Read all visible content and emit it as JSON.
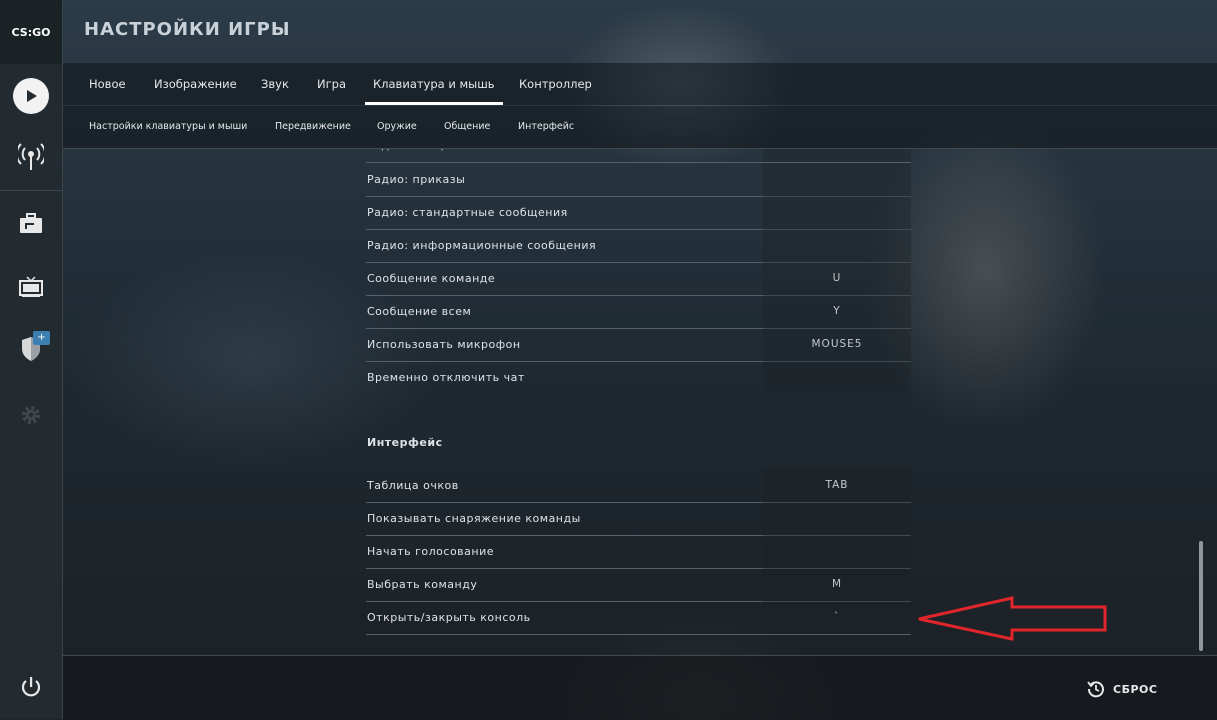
{
  "app": {
    "logo_text": "CS:GO",
    "page_title": "НАСТРОЙКИ ИГРЫ"
  },
  "sidebar": {
    "icons": [
      "play-icon",
      "broadcast-icon",
      "briefcase-icon",
      "tv-icon",
      "shield-icon",
      "gear-icon",
      "power-icon"
    ],
    "badge": "+"
  },
  "tabs": [
    {
      "label": "Новое"
    },
    {
      "label": "Изображение"
    },
    {
      "label": "Звук"
    },
    {
      "label": "Игра"
    },
    {
      "label": "Клавиатура и мышь",
      "active": true
    },
    {
      "label": "Контроллер"
    }
  ],
  "subtabs": [
    {
      "label": "Настройки клавиатуры и мыши"
    },
    {
      "label": "Передвижение"
    },
    {
      "label": "Оружие"
    },
    {
      "label": "Общение"
    },
    {
      "label": "Интерфейс"
    }
  ],
  "communication_rows": [
    {
      "label": "Радиосообщение",
      "key": ""
    },
    {
      "label": "Радио: приказы",
      "key": ""
    },
    {
      "label": "Радио: стандартные сообщения",
      "key": ""
    },
    {
      "label": "Радио: информационные сообщения",
      "key": ""
    },
    {
      "label": "Сообщение команде",
      "key": "U"
    },
    {
      "label": "Сообщение всем",
      "key": "Y"
    },
    {
      "label": "Использовать микрофон",
      "key": "MOUSE5"
    },
    {
      "label": "Временно отключить чат",
      "key": ""
    }
  ],
  "interface_section": {
    "heading": "Интерфейс",
    "rows": [
      {
        "label": "Таблица очков",
        "key": "TAB"
      },
      {
        "label": "Показывать снаряжение команды",
        "key": ""
      },
      {
        "label": "Начать голосование",
        "key": ""
      },
      {
        "label": "Выбрать команду",
        "key": "M"
      },
      {
        "label": "Открыть/закрыть консоль",
        "key": "`"
      }
    ]
  },
  "footer": {
    "reset_label": "СБРОС"
  },
  "colors": {
    "annotation_arrow": "#e0262a",
    "badge": "#3c7fb0"
  }
}
